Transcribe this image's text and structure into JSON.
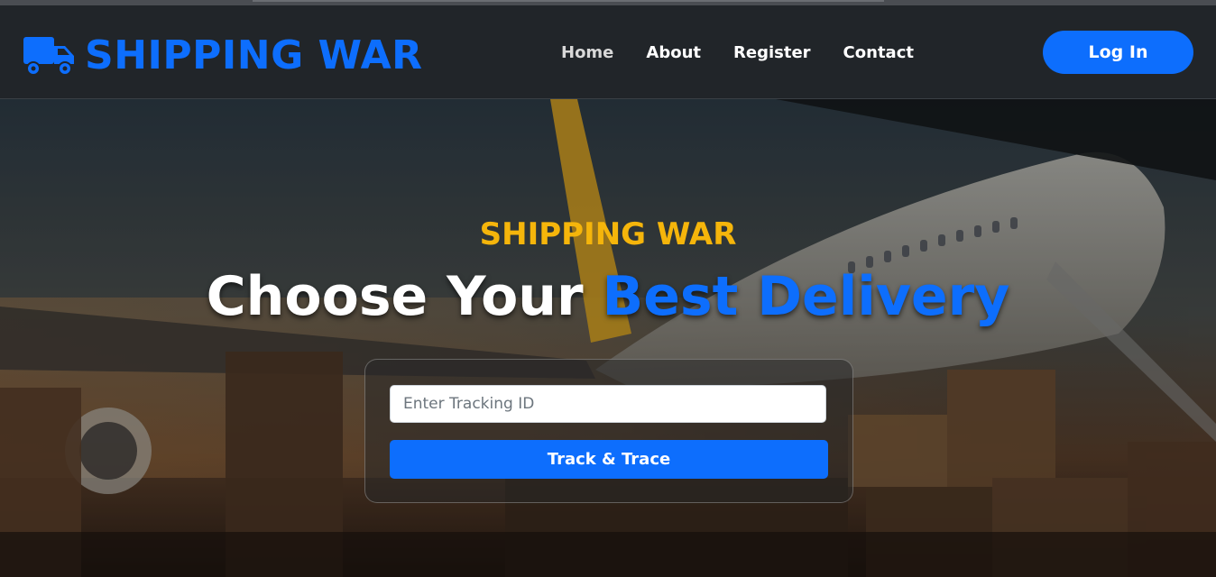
{
  "brand": {
    "name": "SHIPPING WAR",
    "icon": "truck-icon",
    "color": "#0d6efd"
  },
  "nav": {
    "links": [
      {
        "label": "Home",
        "active": true
      },
      {
        "label": "About"
      },
      {
        "label": "Register"
      },
      {
        "label": "Contact"
      }
    ],
    "login_label": "Log In"
  },
  "hero": {
    "subtitle": "SHIPPING WAR",
    "title_plain": "Choose Your ",
    "title_accent": "Best Delivery",
    "background": "cargo airplane loading at airport"
  },
  "tracking": {
    "placeholder": "Enter Tracking ID",
    "value": "",
    "button_label": "Track & Trace"
  },
  "colors": {
    "accent": "#0d6efd",
    "subtitle": "#f5b50b",
    "navbar": "#212529"
  }
}
